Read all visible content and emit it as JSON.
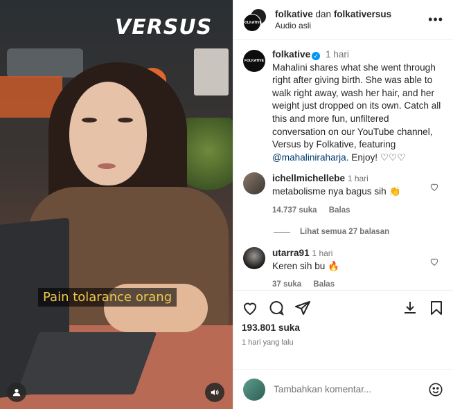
{
  "media": {
    "brand_overlay": "VERSUS",
    "subtitle": "Pain tolarance orang",
    "user_tag_icon": "user-tag-icon",
    "audio_icon": "speaker-icon"
  },
  "header": {
    "user1": "folkative",
    "joiner": " dan ",
    "user2": "folkativersus",
    "audio_label": "Audio asli",
    "avatar_text": "FOLKATIVE"
  },
  "caption": {
    "username": "folkative",
    "time": "1 hari",
    "text_part1": "Mahalini shares what she went through right after giving birth. She was able to walk right away, wash her hair, and her weight just dropped on its own. Catch all this and more fun, unfiltered conversation on our YouTube channel, Versus by Folkative, featuring ",
    "mention": "@mahaliniraharja",
    "text_part2": ". Enjoy! ♡♡♡"
  },
  "comments": [
    {
      "username": "ichellmichellebe",
      "time": "1 hari",
      "text": "metabolisme nya bagus sih 👏",
      "likes": "14.737 suka",
      "reply_label": "Balas"
    },
    {
      "username": "utarra91",
      "time": "1 hari",
      "text": "Keren sih bu 🔥",
      "likes": "37 suka",
      "reply_label": "Balas"
    }
  ],
  "view_replies": "Lihat semua 27 balasan",
  "actions": {
    "like_count": "193.801 suka",
    "time_ago": "1 hari yang lalu"
  },
  "add_comment": {
    "placeholder": "Tambahkan komentar..."
  },
  "colors": {
    "verified": "#0095f6",
    "subtitle": "#f2c94c",
    "mention": "#00376b"
  }
}
